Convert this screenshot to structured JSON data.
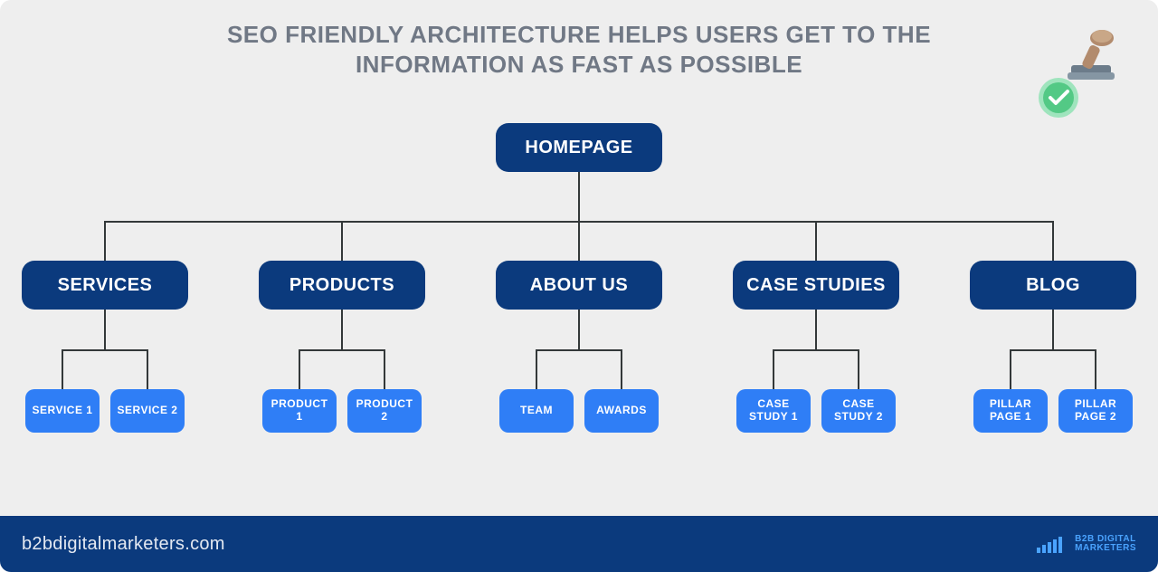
{
  "title": "SEO FRIENDLY ARCHITECTURE HELPS USERS GET TO THE INFORMATION AS FAST AS POSSIBLE",
  "tree": {
    "root": "HOMEPAGE",
    "level1": [
      "SERVICES",
      "PRODUCTS",
      "ABOUT US",
      "CASE STUDIES",
      "BLOG"
    ],
    "level2": [
      [
        "SERVICE 1",
        "SERVICE 2"
      ],
      [
        "PRODUCT 1",
        "PRODUCT 2"
      ],
      [
        "TEAM",
        "AWARDS"
      ],
      [
        "CASE STUDY 1",
        "CASE STUDY 2"
      ],
      [
        "PILLAR PAGE 1",
        "PILLAR PAGE 2"
      ]
    ]
  },
  "footer": {
    "site": "b2bdigitalmarketers.com",
    "brand_line1": "B2B DIGITAL",
    "brand_line2": "MARKETERS"
  },
  "colors": {
    "background": "#eeeeee",
    "node_dark": "#0b3a7d",
    "node_light": "#2f7ef6",
    "connector": "#333839",
    "title_text": "#707885",
    "footer_bg": "#0b3a7d",
    "brand_accent": "#4aa3ff",
    "stamp_handle": "#b28b6d",
    "stamp_base": "#6c7c8a",
    "check_bg": "#6fd49a",
    "check_mark": "#ffffff"
  }
}
